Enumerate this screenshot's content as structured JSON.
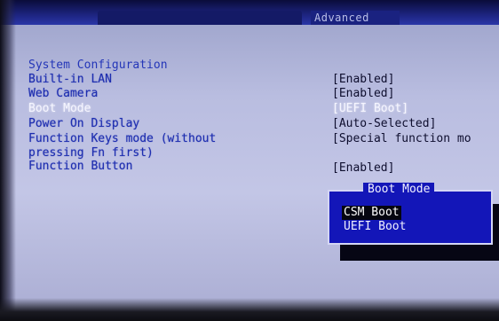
{
  "tabs": {
    "main_label": "",
    "advanced_label": "Advanced"
  },
  "section_title": "System Configuration",
  "settings": [
    {
      "label": "Built-in LAN",
      "value": "[Enabled]"
    },
    {
      "label": "Web Camera",
      "value": "[Enabled]"
    },
    {
      "label": "Boot Mode",
      "value": "[UEFI Boot]"
    },
    {
      "label": "Power On Display",
      "value": "[Auto-Selected]"
    },
    {
      "label": "Function Keys mode (without",
      "label2": "pressing Fn first)",
      "value": "[Special function mo"
    },
    {
      "label": "Function Button",
      "value": "[Enabled]"
    }
  ],
  "popup": {
    "title": "Boot Mode",
    "options": [
      "CSM Boot",
      "UEFI Boot"
    ],
    "highlighted_index": 0
  },
  "colors": {
    "background": "#b9bde0",
    "label_blue": "#1e2eb0",
    "popup_blue": "#1316b8"
  }
}
